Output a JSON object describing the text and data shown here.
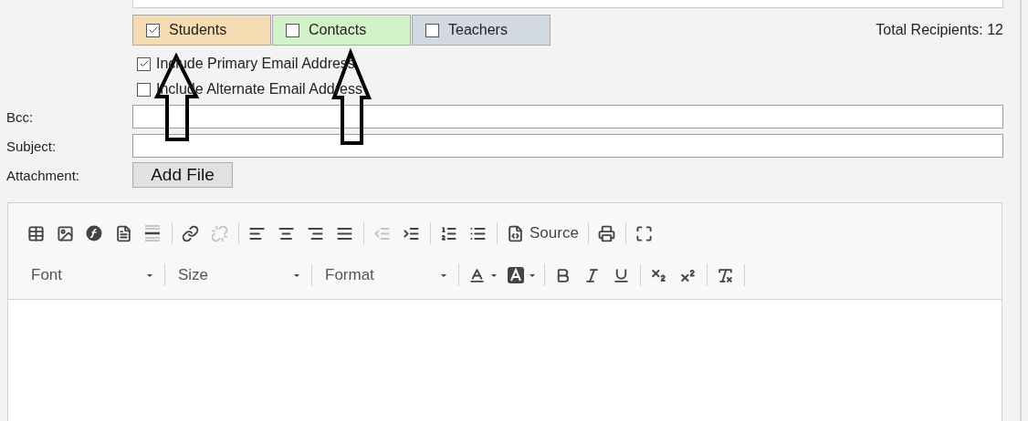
{
  "recipient_tabs": [
    {
      "label": "Students",
      "checked": true,
      "color": "#f6dcb3"
    },
    {
      "label": "Contacts",
      "checked": false,
      "color": "#d4f2c9"
    },
    {
      "label": "Teachers",
      "checked": false,
      "color": "#d3d9e3"
    }
  ],
  "total_recipients": "Total Recipients: 12",
  "email_options": [
    {
      "label": "Include Primary Email Address",
      "checked": true
    },
    {
      "label": "Include Alternate Email Address",
      "checked": false
    }
  ],
  "fields": [
    {
      "label": "Bcc:"
    },
    {
      "label": "Subject:"
    }
  ],
  "attachment": {
    "label": "Attachment:",
    "button": "Add File"
  },
  "toolbar_rows": [
    {
      "groups": [
        [
          {
            "kind": "button",
            "disabled": false
          },
          {
            "kind": "button",
            "disabled": false
          },
          {
            "kind": "button",
            "disabled": false
          },
          {
            "kind": "button",
            "disabled": false
          },
          {
            "kind": "button",
            "disabled": false
          }
        ],
        [
          {
            "kind": "button",
            "disabled": false
          },
          {
            "kind": "button",
            "disabled": true
          }
        ],
        [
          {
            "kind": "button",
            "disabled": false
          },
          {
            "kind": "button",
            "disabled": false
          },
          {
            "kind": "button",
            "disabled": false
          },
          {
            "kind": "button",
            "disabled": false
          }
        ],
        [
          {
            "kind": "button",
            "disabled": true
          },
          {
            "kind": "button",
            "disabled": false
          }
        ],
        [
          {
            "kind": "button",
            "disabled": false
          },
          {
            "kind": "button",
            "disabled": false
          }
        ],
        [
          {
            "kind": "button",
            "disabled": false,
            "label": "Source"
          }
        ],
        [
          {
            "kind": "button",
            "disabled": false
          }
        ],
        [
          {
            "kind": "button",
            "disabled": false
          }
        ]
      ]
    },
    {
      "groups": [
        [
          {
            "kind": "combo",
            "label": "Font"
          }
        ],
        [
          {
            "kind": "combo",
            "label": "Size"
          }
        ],
        [
          {
            "kind": "combo",
            "label": "Format"
          }
        ],
        [
          {
            "kind": "dropdown",
            "disabled": false
          },
          {
            "kind": "dropdown",
            "disabled": false
          }
        ],
        [
          {
            "kind": "button",
            "disabled": false
          },
          {
            "kind": "button",
            "disabled": false
          },
          {
            "kind": "button",
            "disabled": false
          }
        ],
        [
          {
            "kind": "button",
            "disabled": false
          },
          {
            "kind": "button",
            "disabled": false
          }
        ],
        [
          {
            "kind": "button",
            "disabled": false
          }
        ]
      ]
    }
  ]
}
